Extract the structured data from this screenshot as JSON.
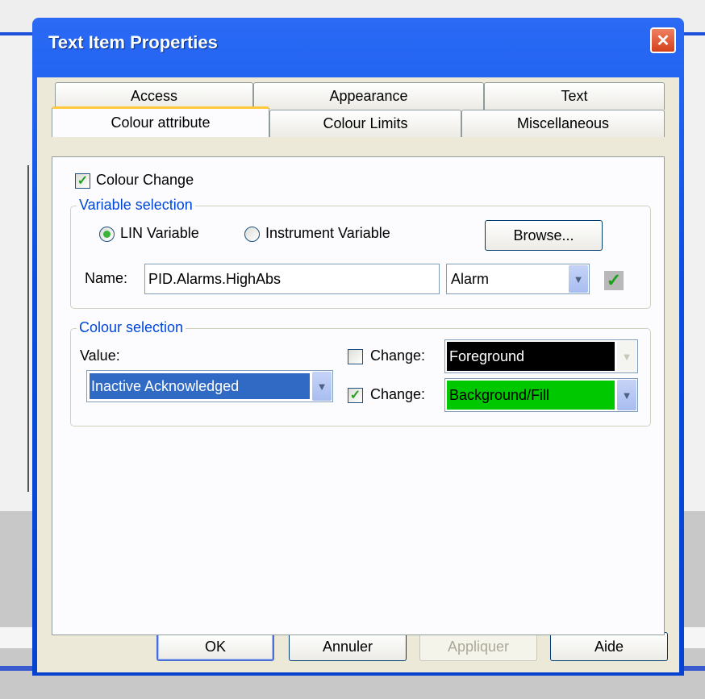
{
  "dialog": {
    "title": "Text Item Properties"
  },
  "tabs_back": [
    "Access",
    "Appearance",
    "Text"
  ],
  "tabs_front": [
    "Colour attribute",
    "Colour Limits",
    "Miscellaneous"
  ],
  "colour_change": {
    "label": "Colour Change",
    "checked": true
  },
  "variable_selection": {
    "title": "Variable selection",
    "radio_lin": "LIN Variable",
    "radio_instrument": "Instrument Variable",
    "selected": "LIN Variable",
    "browse_label": "Browse...",
    "name_label": "Name:",
    "name_value": "PID.Alarms.HighAbs",
    "type_value": "Alarm"
  },
  "colour_selection": {
    "title": "Colour selection",
    "value_label": "Value:",
    "value_selected": "Inactive Acknowledged",
    "change1": {
      "label": "Change:",
      "checked": false,
      "value": "Foreground",
      "color": "#000000",
      "text_color": "#ffffff"
    },
    "change2": {
      "label": "Change:",
      "checked": true,
      "value": "Background/Fill",
      "color": "#00c800",
      "text_color": "#000000"
    }
  },
  "footer": {
    "ok": "OK",
    "cancel": "Annuler",
    "apply": "Appliquer",
    "help": "Aide"
  }
}
